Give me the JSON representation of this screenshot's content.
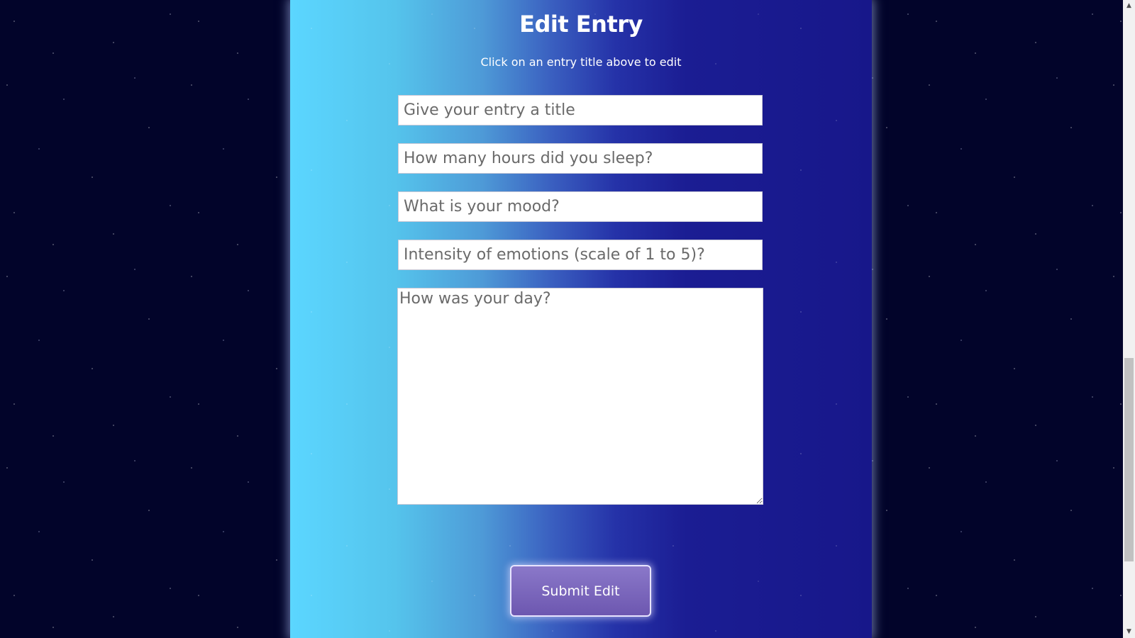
{
  "page": {
    "title": "Edit Entry",
    "subtitle": "Click on an entry title above to edit"
  },
  "form": {
    "title_placeholder": "Give your entry a title",
    "sleep_placeholder": "How many hours did you sleep?",
    "mood_placeholder": "What is your mood?",
    "intensity_placeholder": "Intensity of emotions (scale of 1 to 5)?",
    "day_placeholder": "How was your day?",
    "submit_label": "Submit Edit"
  },
  "scrollbar": {
    "up_icon": "▲",
    "down_icon": "▼"
  },
  "colors": {
    "background": "#02042a",
    "panel_left": "#5bd6ff",
    "panel_right": "#17178a",
    "button": "#7a66bd"
  }
}
